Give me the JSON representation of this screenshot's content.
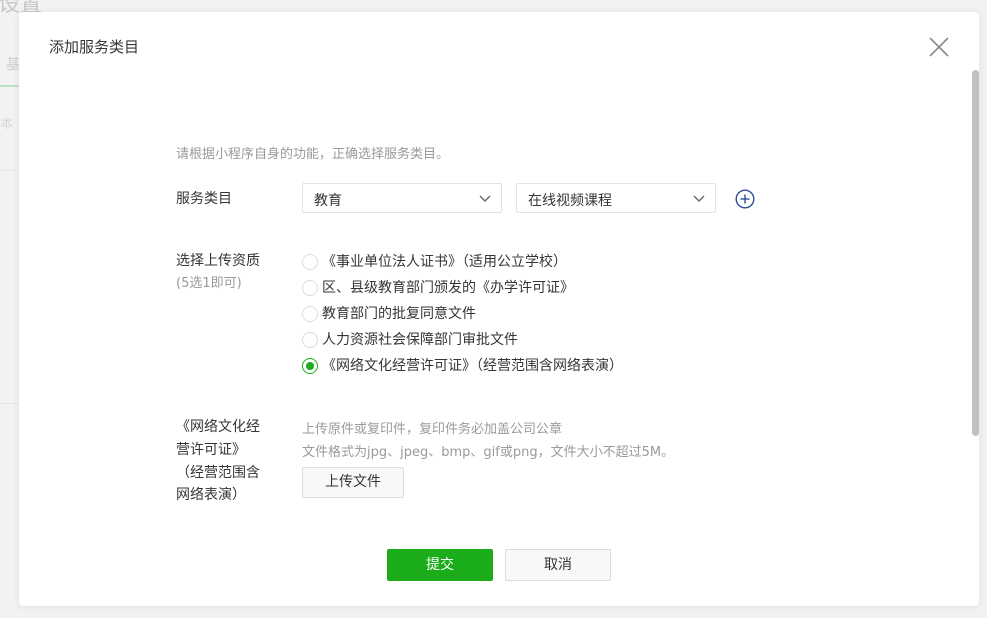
{
  "background": {
    "title": "设置",
    "tab": "基",
    "text": "本"
  },
  "dialog": {
    "title": "添加服务类目",
    "hint": "请根据小程序自身的功能，正确选择服务类目。",
    "category_label": "服务类目",
    "category_primary": "教育",
    "category_secondary": "在线视频课程",
    "qualification_label": "选择上传资质",
    "qualification_sub": "(5选1即可)",
    "qualifications": [
      {
        "label": "《事业单位法人证书》（适用公立学校）",
        "checked": false
      },
      {
        "label": "区、县级教育部门颁发的《办学许可证》",
        "checked": false
      },
      {
        "label": "教育部门的批复同意文件",
        "checked": false
      },
      {
        "label": "人力资源社会保障部门审批文件",
        "checked": false
      },
      {
        "label": "《网络文化经营许可证》（经营范围含网络表演）",
        "checked": true
      }
    ],
    "upload_label_lines": [
      "《网络文化经",
      "营许可证》",
      "（经营范围含",
      "网络表演）"
    ],
    "upload_tip_1": "上传原件或复印件，复印件务必加盖公司公章",
    "upload_tip_2": "文件格式为jpg、jpeg、bmp、gif或png，文件大小不超过5M。",
    "upload_button": "上传文件",
    "submit_button": "提交",
    "cancel_button": "取消"
  },
  "colors": {
    "primary": "#1aad19",
    "accent_icon": "#2e4e9c"
  }
}
